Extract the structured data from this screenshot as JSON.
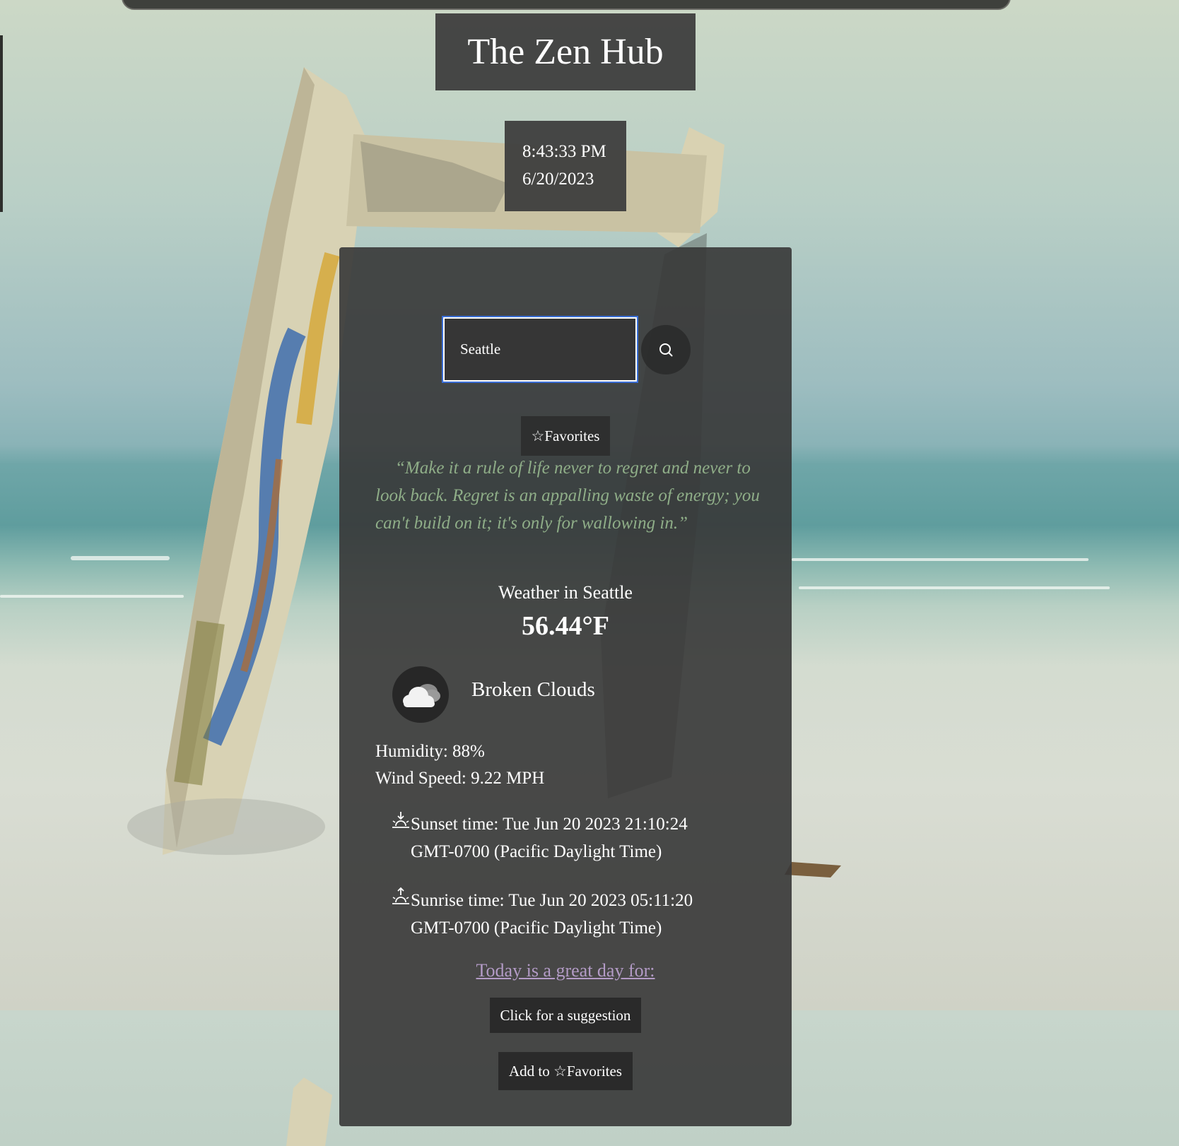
{
  "header": {
    "title": "The Zen Hub"
  },
  "clock": {
    "time": "8:43:33 PM",
    "date": "6/20/2023"
  },
  "search": {
    "value": "Seattle",
    "icon": "search-icon"
  },
  "favorites_button": {
    "label": "☆Favorites"
  },
  "quote": {
    "text": "“Make it a rule of life never to regret and never to look back. Regret is an appalling waste of energy; you can't build on it; it's only for wallowing in.”"
  },
  "weather": {
    "title": "Weather in Seattle",
    "temperature": "56.44°F",
    "condition_icon": "broken-clouds-icon",
    "condition": "Broken Clouds",
    "humidity": "Humidity: 88%",
    "wind": "Wind Speed: 9.22 MPH",
    "sunset_icon": "sunset-icon",
    "sunset": "Sunset time: Tue Jun 20 2023 21:10:24 GMT-0700 (Pacific Daylight Time)",
    "sunrise_icon": "sunrise-icon",
    "sunrise": "Sunrise time: Tue Jun 20 2023 05:11:20 GMT-0700 (Pacific Daylight Time)"
  },
  "suggestion": {
    "link_text": "Today is a great day for:",
    "button_label": "Click for a suggestion",
    "add_favorites_label": "Add to ☆Favorites"
  },
  "colors": {
    "panel_bg": "#373737",
    "quote_text": "#8fae88",
    "link_text": "#b39bc6",
    "input_focus": "#3b6fd8"
  }
}
